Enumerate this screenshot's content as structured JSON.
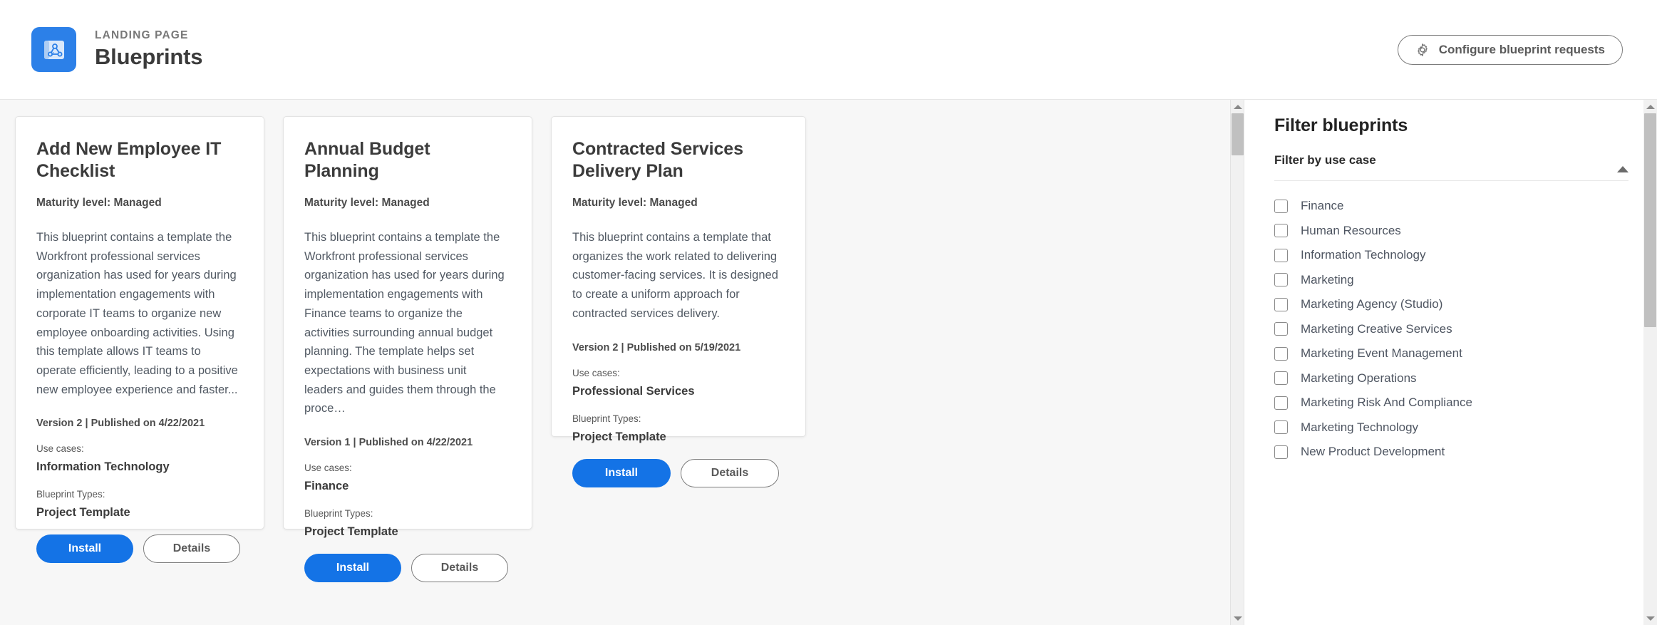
{
  "header": {
    "eyebrow": "LANDING PAGE",
    "title": "Blueprints",
    "logo_icon": "blueprint-icon",
    "configure_button": {
      "label": "Configure blueprint requests",
      "icon": "gear-icon"
    }
  },
  "colors": {
    "accent": "#1473e6",
    "logo_bg": "#2c80e8",
    "page_bg": "#f7f7f7",
    "card_bg": "#ffffff",
    "text_primary": "#3b3b3b",
    "text_body": "#515963",
    "border": "#e3e3e3",
    "scrollbar_thumb": "#c0c0c0"
  },
  "cards": [
    {
      "title": "Add New Employee IT Checklist",
      "maturity": "Maturity level: Managed",
      "description": "This blueprint contains a template the Workfront professional services organization has used for years during implementation engagements with corporate IT teams to organize new employee onboarding activities. Using this template allows IT teams to operate efficiently, leading to a positive new employee experience and faster...",
      "version": "Version 2 | Published on 4/22/2021",
      "use_cases_label": "Use cases:",
      "use_cases_value": "Information Technology",
      "types_label": "Blueprint Types:",
      "types_value": "Project Template",
      "install_label": "Install",
      "details_label": "Details"
    },
    {
      "title": "Annual Budget Planning",
      "maturity": "Maturity level: Managed",
      "description": "This blueprint contains a template the Workfront professional services organization has used for years during implementation engagements with Finance teams to organize the activities surrounding annual budget planning. The template helps set expectations with business unit leaders and guides them through the proce…",
      "version": "Version 1 | Published on 4/22/2021",
      "use_cases_label": "Use cases:",
      "use_cases_value": "Finance",
      "types_label": "Blueprint Types:",
      "types_value": "Project Template",
      "install_label": "Install",
      "details_label": "Details"
    },
    {
      "title": "Contracted Services Delivery Plan",
      "maturity": "Maturity level: Managed",
      "description": "This blueprint contains a template that organizes the work related to delivering customer-facing services. It is designed to create a uniform approach for contracted services delivery.",
      "version": "Version 2 | Published on 5/19/2021",
      "use_cases_label": "Use cases:",
      "use_cases_value": "Professional Services",
      "types_label": "Blueprint Types:",
      "types_value": "Project Template",
      "install_label": "Install",
      "details_label": "Details"
    }
  ],
  "filter_panel": {
    "title": "Filter blueprints",
    "section_label": "Filter by use case",
    "collapse_icon": "chevron-up-icon",
    "options": [
      {
        "label": "Finance",
        "checked": false
      },
      {
        "label": "Human Resources",
        "checked": false
      },
      {
        "label": "Information Technology",
        "checked": false
      },
      {
        "label": "Marketing",
        "checked": false
      },
      {
        "label": "Marketing Agency (Studio)",
        "checked": false
      },
      {
        "label": "Marketing Creative Services",
        "checked": false
      },
      {
        "label": "Marketing Event Management",
        "checked": false
      },
      {
        "label": "Marketing Operations",
        "checked": false
      },
      {
        "label": "Marketing Risk And Compliance",
        "checked": false
      },
      {
        "label": "Marketing Technology",
        "checked": false
      },
      {
        "label": "New Product Development",
        "checked": false
      }
    ]
  }
}
